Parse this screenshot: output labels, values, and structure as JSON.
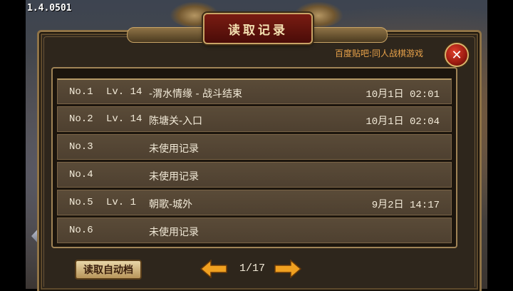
{
  "version": "1.4.0501",
  "header": {
    "title": "读取记录"
  },
  "tagline": "百度贴吧:同人战棋游戏",
  "close_label": "✕",
  "slots": [
    {
      "no": "No.1",
      "lv": "Lv. 14",
      "name": "-渭水情缘 - 战斗结束",
      "time": "10月1日  02:01"
    },
    {
      "no": "No.2",
      "lv": "Lv. 14",
      "name": " 陈塘关-入口",
      "time": "10月1日  02:04"
    },
    {
      "no": "No.3",
      "lv": "",
      "name": "未使用记录",
      "time": ""
    },
    {
      "no": "No.4",
      "lv": "",
      "name": "未使用记录",
      "time": ""
    },
    {
      "no": "No.5",
      "lv": "Lv. 1",
      "name": " 朝歌-城外",
      "time": "9月2日  14:17"
    },
    {
      "no": "No.6",
      "lv": "",
      "name": "未使用记录",
      "time": ""
    }
  ],
  "footer": {
    "auto_save_label": "读取自动档",
    "page": "1/17"
  },
  "colors": {
    "accent": "#e8a24a",
    "arrow": "#f0a020"
  }
}
